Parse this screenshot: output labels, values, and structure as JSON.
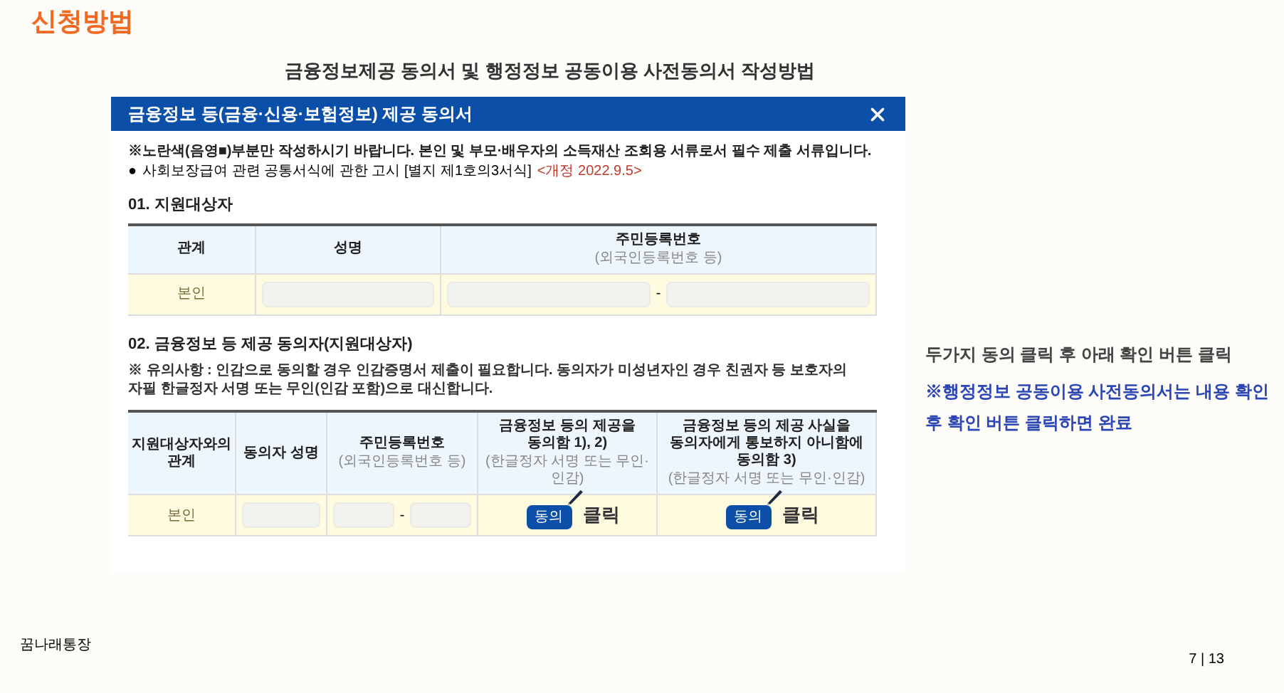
{
  "section_title": "신청방법",
  "page_title": "금융정보제공 동의서 및 행정정보 공동이용 사전동의서 작성방법",
  "form": {
    "title": "금융정보 등(금융·신용·보험정보) 제공 동의서",
    "notes": [
      {
        "text": "※노란색(음영■)부분만 작성하시기 바랍니다. 본인 및 부모·배우자의 소득재산 조회용 서류로서 필수 제출 서류입니다."
      },
      {
        "bullet": "●",
        "text": "사회보장급여 관련 공통서식에 관한 고시 [별지 제1호의3서식]",
        "revision": "<개정 2022.9.5>"
      }
    ],
    "sections": [
      {
        "heading": "01. 지원대상자",
        "columns": [
          {
            "label": "관계"
          },
          {
            "label": "성명"
          },
          {
            "label": "주민등록번호",
            "sub": "(외국인등록번호 등)"
          }
        ],
        "rows": [
          [
            {
              "kind": "text",
              "text": "본인"
            },
            {
              "kind": "input"
            },
            {
              "kind": "id",
              "dash": "-"
            }
          ]
        ]
      },
      {
        "heading": "02. 금융정보 등 제공 동의자(지원대상자)",
        "note": "※ 유의사항 : 인감으로 동의할 경우 인감증명서 제출이 필요합니다. 동의자가 미성년자인 경우 친권자 등 보호자의 자필 한글정자 서명 또는 무인(인감 포함)으로 대신합니다.",
        "columns": [
          {
            "label": "지원대상자와의 관계"
          },
          {
            "label": "동의자 성명"
          },
          {
            "label": "주민등록번호",
            "sub": "(외국인등록번호 등)"
          },
          {
            "label": "금융정보 등의 제공을 동의함 1), 2)",
            "sub": "(한글정자 서명 또는 무인·인감)"
          },
          {
            "label": "금융정보 등의 제공 사실을 동의자에게 통보하지 아니함에 동의함 3)",
            "sub": "(한글정자 서명 또는 무인·인감)"
          }
        ],
        "rows": [
          [
            {
              "kind": "text",
              "text": "본인"
            },
            {
              "kind": "input"
            },
            {
              "kind": "id",
              "dash": "-"
            },
            {
              "kind": "agree",
              "button": "동의",
              "annotation": "클릭"
            },
            {
              "kind": "agree",
              "button": "동의",
              "annotation": "클릭"
            }
          ]
        ]
      }
    ]
  },
  "instructions": [
    {
      "kind": "plain",
      "text": "두가지 동의 클릭 후 아래 확인 버튼 클릭"
    },
    {
      "kind": "highlight",
      "text": "※행정정보 공동이용 사전동의서는 내용 확인 후 확인 버튼 클릭하면 완료"
    }
  ],
  "footer": {
    "brand": "꿈나래통장",
    "page": "7 | 13"
  }
}
